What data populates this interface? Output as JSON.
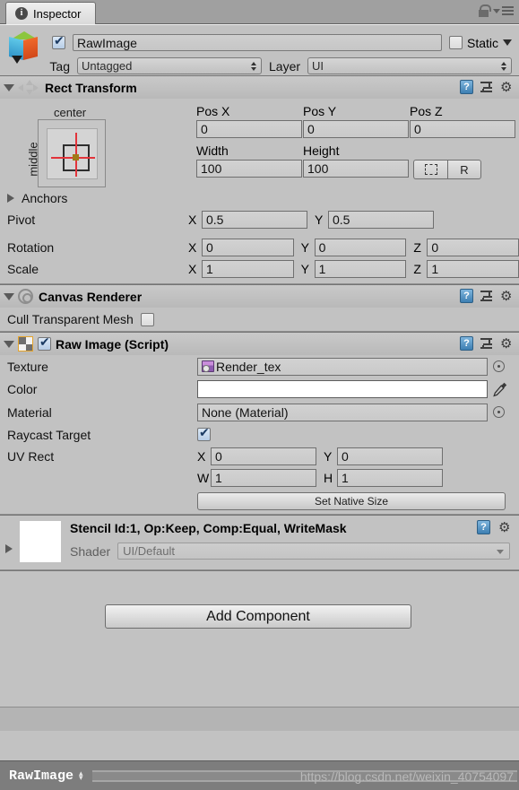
{
  "window": {
    "tab_label": "Inspector",
    "tab_icon": "info-icon",
    "lock_icon": "lock-icon",
    "menu_icon": "hamburger-menu-icon"
  },
  "game_object": {
    "icon": "gameobject-cube-icon",
    "enabled": true,
    "name": "RawImage",
    "static_label": "Static",
    "static_checked": false,
    "tag_label": "Tag",
    "tag_value": "Untagged",
    "layer_label": "Layer",
    "layer_value": "UI"
  },
  "components": [
    {
      "title": "Rect Transform",
      "icon": "rect-transform-icon",
      "expanded": true,
      "anchor_preset": {
        "horizontal": "center",
        "vertical": "middle"
      },
      "fields": {
        "pos_x_label": "Pos X",
        "pos_x": "0",
        "pos_y_label": "Pos Y",
        "pos_y": "0",
        "pos_z_label": "Pos Z",
        "pos_z": "0",
        "width_label": "Width",
        "width": "100",
        "height_label": "Height",
        "height": "100",
        "blueprint_button": "blueprint-mode-icon",
        "raw_button": "R",
        "anchors_label": "Anchors",
        "pivot_label": "Pivot",
        "pivot_x": "0.5",
        "pivot_y": "0.5",
        "rotation_label": "Rotation",
        "rot_x": "0",
        "rot_y": "0",
        "rot_z": "0",
        "scale_label": "Scale",
        "scale_x": "1",
        "scale_y": "1",
        "scale_z": "1",
        "axis_x": "X",
        "axis_y": "Y",
        "axis_z": "Z"
      }
    },
    {
      "title": "Canvas Renderer",
      "icon": "canvas-renderer-icon",
      "expanded": true,
      "cull_label": "Cull Transparent Mesh",
      "cull_checked": false
    },
    {
      "title": "Raw Image (Script)",
      "icon": "raw-image-script-icon",
      "expanded": true,
      "enabled": true,
      "rows": {
        "texture_label": "Texture",
        "texture_value": "Render_tex",
        "color_label": "Color",
        "color_value": "#FFFFFF",
        "material_label": "Material",
        "material_value": "None (Material)",
        "raycast_label": "Raycast Target",
        "raycast_checked": true,
        "uv_rect_label": "UV Rect",
        "uv_x_axis": "X",
        "uv_x": "0",
        "uv_y_axis": "Y",
        "uv_y": "0",
        "uv_w_axis": "W",
        "uv_w": "1",
        "uv_h_axis": "H",
        "uv_h": "1",
        "set_native_size_button": "Set Native Size"
      }
    }
  ],
  "material_block": {
    "title": "Stencil Id:1, Op:Keep, Comp:Equal, WriteMask",
    "shader_label": "Shader",
    "shader_value": "UI/Default",
    "thumbnail": "material-preview-thumbnail"
  },
  "add_component": {
    "label": "Add Component"
  },
  "status_bar": {
    "object_name": "RawImage",
    "grip_icon": "drag-handle-icon",
    "watermark": "https://blog.csdn.net/weixin_40754097"
  },
  "icons": {
    "help": "?",
    "preset": "preset-icon",
    "gear": "⚙",
    "eyedropper": "eyedropper-icon",
    "object_selector": "object-selector-dot-icon"
  }
}
